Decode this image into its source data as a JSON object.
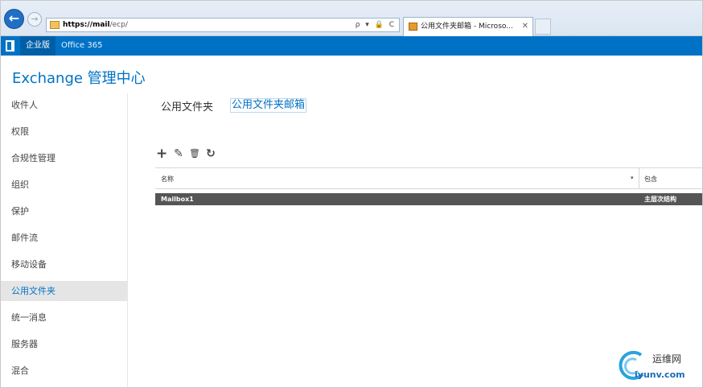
{
  "browser": {
    "back_label": "←",
    "forward_label": "→",
    "url_host": "https://mail",
    "url_path": "/ecp/",
    "address_tools": "ρ ▾ 🔒 C",
    "tab_title": "公用文件夹邮箱 - Microso...",
    "tab_close": "✕"
  },
  "office_bar": {
    "enterprise_label": "企业版",
    "o365_label": "Office 365"
  },
  "header": {
    "title": "Exchange 管理中心"
  },
  "sidebar": {
    "items": [
      {
        "label": "收件人"
      },
      {
        "label": "权限"
      },
      {
        "label": "合规性管理"
      },
      {
        "label": "组织"
      },
      {
        "label": "保护"
      },
      {
        "label": "邮件流"
      },
      {
        "label": "移动设备"
      },
      {
        "label": "公用文件夹",
        "selected": true
      },
      {
        "label": "统一消息"
      },
      {
        "label": "服务器"
      },
      {
        "label": "混合"
      }
    ]
  },
  "main": {
    "tabs": [
      {
        "label": "公用文件夹"
      },
      {
        "label": "公用文件夹邮箱",
        "active": true
      }
    ],
    "toolbar": {
      "add": "+",
      "edit": "✎",
      "delete": "🗑",
      "refresh": "↻"
    },
    "grid": {
      "columns": [
        "名称",
        "包含"
      ],
      "sort_indicator": "▾",
      "rows": [
        {
          "name": "Mailbox1",
          "contains": "主层次结构"
        }
      ]
    }
  },
  "watermark": {
    "cn": "运维网",
    "en": "iyunv.com"
  },
  "colors": {
    "accent": "#0072c6",
    "selected_row": "#555555",
    "nav_selected": "#e5e5e5"
  }
}
